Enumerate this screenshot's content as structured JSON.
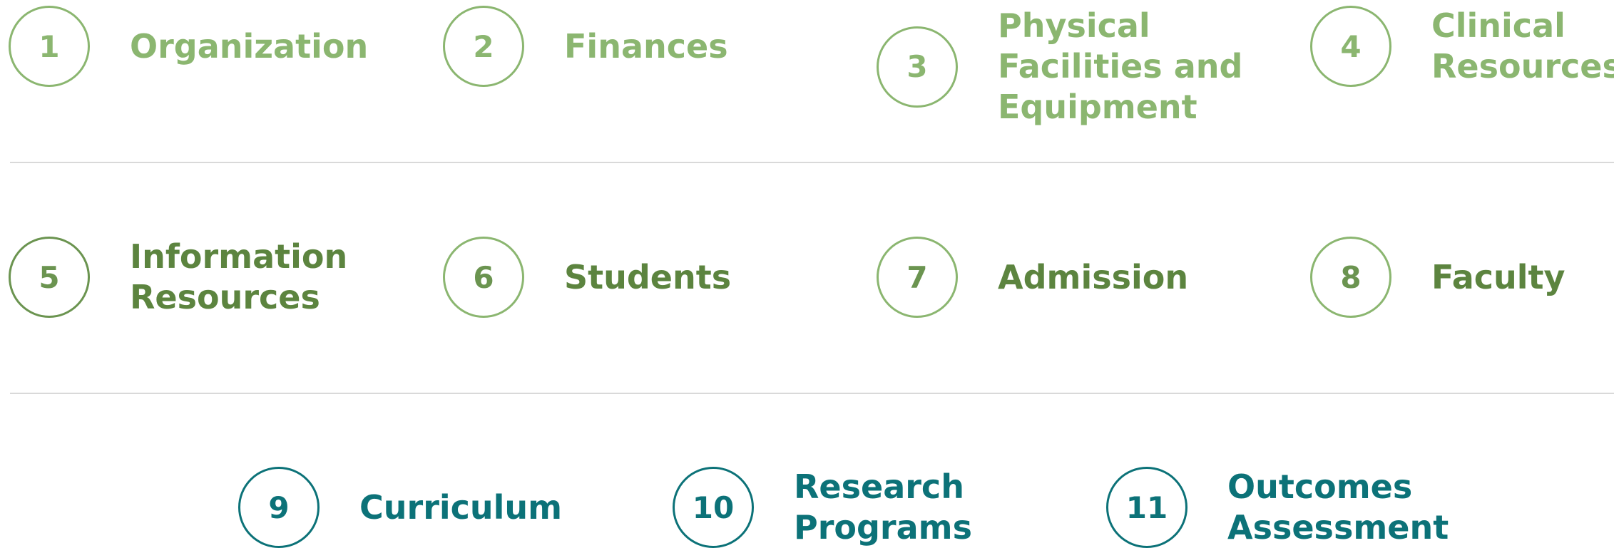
{
  "items": [
    {
      "number": "1",
      "label": "Organization"
    },
    {
      "number": "2",
      "label": "Finances"
    },
    {
      "number": "3",
      "label": "Physical\nFacilities and\nEquipment"
    },
    {
      "number": "4",
      "label": "Clinical\nResources"
    },
    {
      "number": "5",
      "label": "Information\nResources"
    },
    {
      "number": "6",
      "label": "Students"
    },
    {
      "number": "7",
      "label": "Admission"
    },
    {
      "number": "8",
      "label": "Faculty"
    },
    {
      "number": "9",
      "label": "Curriculum"
    },
    {
      "number": "10",
      "label": "Research\nPrograms"
    },
    {
      "number": "11",
      "label": "Outcomes\nAssessment"
    }
  ],
  "colors": {
    "row1": "#8bb670",
    "row2": "#5c843f",
    "row3": "#0c7278",
    "divider": "#d9d9d9"
  }
}
